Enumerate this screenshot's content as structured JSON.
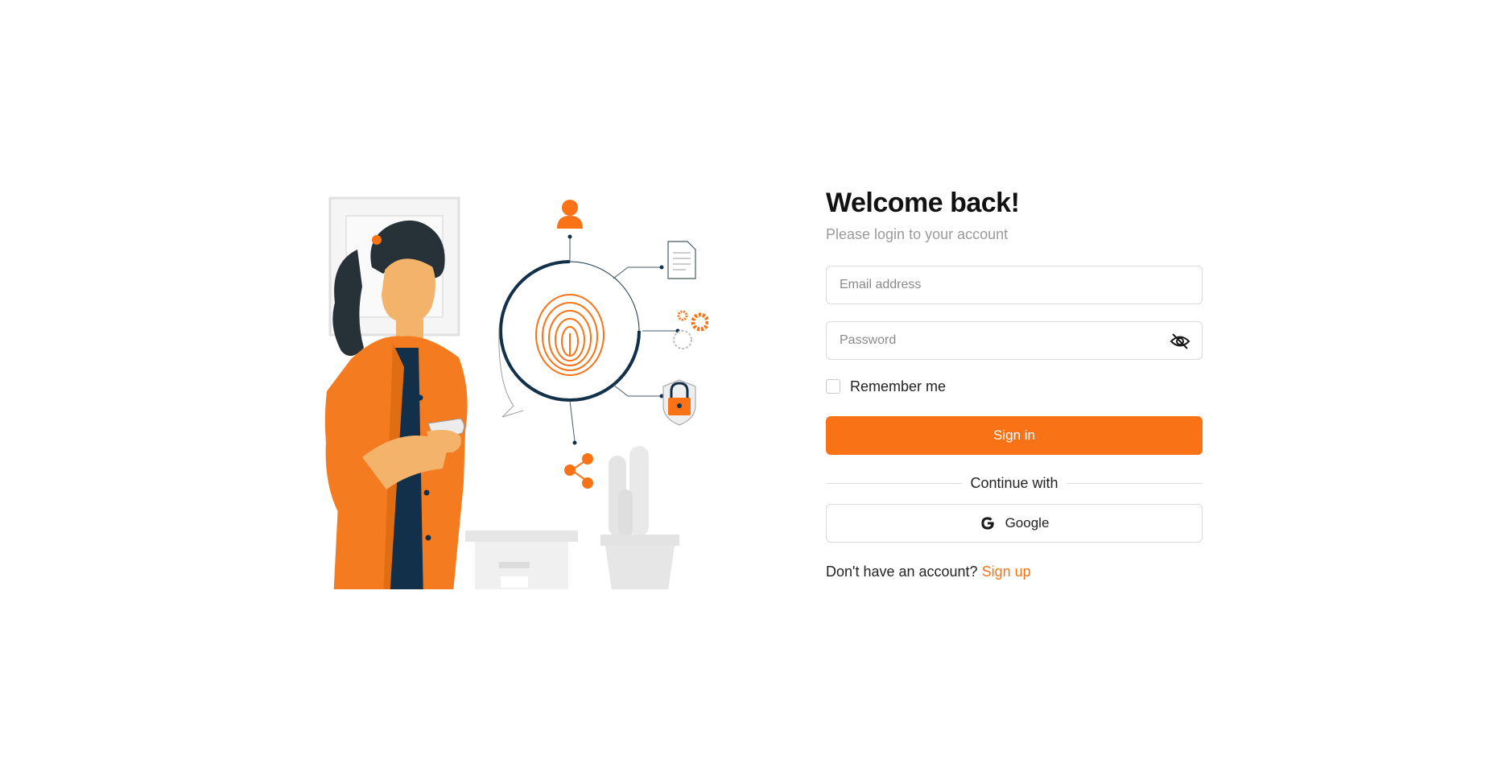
{
  "login": {
    "title": "Welcome back!",
    "subtitle": "Please login to your account",
    "email_placeholder": "Email address",
    "password_placeholder": "Password",
    "remember_label": "Remember me",
    "signin_label": "Sign in",
    "divider_text": "Continue with",
    "google_label": "Google",
    "signup_prompt": "Don't have an account?",
    "signup_link": "Sign up"
  },
  "icons": {
    "password_toggle": "eye-off-icon",
    "google": "google-icon"
  },
  "colors": {
    "accent": "#f97316",
    "text": "#1a1a1a",
    "muted": "#9a9a9a",
    "border": "#d9d9d9"
  }
}
